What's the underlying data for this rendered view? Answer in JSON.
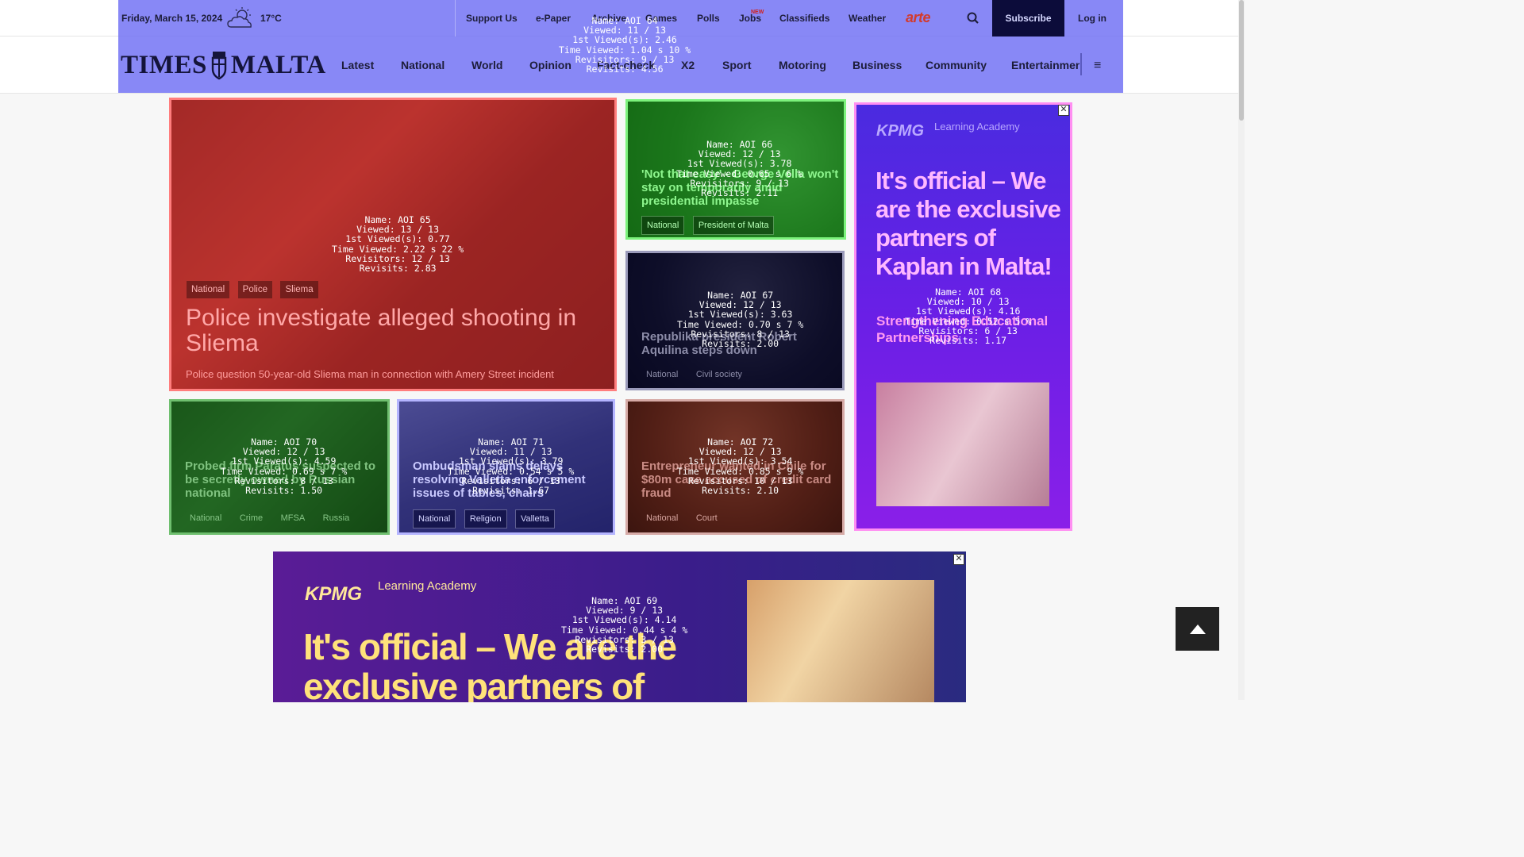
{
  "header": {
    "date": "Friday, March 15, 2024",
    "weather_icon": "partly-cloudy-icon",
    "temperature": "17°C",
    "utility_links": [
      "Support Us",
      "e-Paper",
      "Archive",
      "Games",
      "Polls",
      "Jobs",
      "Classifieds",
      "Weather"
    ],
    "jobs_badge": "NEW",
    "arte_logo": "arte",
    "search_icon": "search-icon",
    "subscribe_label": "Subscribe",
    "login_label": "Log in",
    "logo_text_left": "TIMES",
    "logo_text_right": "MALTA",
    "nav_links": [
      "Latest",
      "National",
      "World",
      "Opinion",
      "Fact-check",
      "X2",
      "Sport",
      "Motoring",
      "Business",
      "Community",
      "Entertainment"
    ],
    "menu_icon": "≡",
    "aoi": [
      "Name: AOI 64",
      "Viewed: 11 / 13",
      "1st Viewed(s): 2.46",
      "Time Viewed: 1.04 s 10 %",
      "Revisitors: 9 / 13",
      "Revisits: 4.56"
    ]
  },
  "cards": {
    "c65": {
      "tags": [
        "National",
        "Police",
        "Sliema"
      ],
      "title": "Police investigate alleged shooting in Sliema",
      "subtitle": "Police question 50-year-old Sliema man in connection with Amery Street incident",
      "aoi": [
        "Name: AOI 65",
        "Viewed: 13 / 13",
        "1st Viewed(s): 0.77",
        "Time Viewed: 2.22 s 22 %",
        "Revisitors: 12 / 13",
        "Revisits: 2.83"
      ]
    },
    "c66": {
      "title": "'Not that easy' - George Vella won't stay on temporarily amid presidential impasse",
      "tags": [
        "National",
        "President of Malta"
      ],
      "aoi": [
        "Name: AOI 66",
        "Viewed: 12 / 13",
        "1st Viewed(s): 3.78",
        "Time Viewed: 0.65 s 6 %",
        "Revisitors: 9 / 13",
        "Revisits: 2.11"
      ]
    },
    "c67": {
      "title": "Republika president Robert Aquilina steps down",
      "tags": [
        "National",
        "Civil society"
      ],
      "aoi": [
        "Name: AOI 67",
        "Viewed: 12 / 13",
        "1st Viewed(s): 3.63",
        "Time Viewed: 0.70 s 7 %",
        "Revisitors: 8 / 13",
        "Revisits: 2.00"
      ]
    },
    "c68": {
      "kpmg": "KPMG",
      "academy": "Learning Academy",
      "headline": "It's official – We are the exclusive partners of Kaplan in Malta!",
      "strength": "Strengthening Educational Partnerships",
      "close": "✕",
      "aoi": [
        "Name: AOI 68",
        "Viewed: 10 / 13",
        "1st Viewed(s): 4.16",
        "Time Viewed: 0.52 s 5 %",
        "Revisitors: 6 / 13",
        "Revisits: 1.17"
      ]
    },
    "c70": {
      "title": "Probed firm Paratus suspected to be secretly owned by Russian national",
      "tags": [
        "National",
        "Crime",
        "MFSA",
        "Russia"
      ],
      "aoi": [
        "Name: AOI 70",
        "Viewed: 12 / 13",
        "1st Viewed(s): 4.59",
        "Time Viewed: 0.69 s 7 %",
        "Revisitors: 8 / 13",
        "Revisits: 1.50"
      ]
    },
    "c71": {
      "title": "Ombudsman slams delays resolving Valletta enforcement issues of tables, chairs",
      "tags": [
        "National",
        "Religion",
        "Valletta"
      ],
      "aoi": [
        "Name: AOI 71",
        "Viewed: 11 / 13",
        "1st Viewed(s): 3.79",
        "Time Viewed: 0.54 s 5 %",
        "Revisitors: 6 / 13",
        "Revisits: 1.67"
      ]
    },
    "c72": {
      "title": "Entrepreneur wanted in Chile for $80m case accused of credit card fraud",
      "tags": [
        "National",
        "Court"
      ],
      "aoi": [
        "Name: AOI 72",
        "Viewed: 12 / 13",
        "1st Viewed(s): 3.54",
        "Time Viewed: 0.85 s 9 %",
        "Revisitors: 10 / 13",
        "Revisits: 2.10"
      ]
    },
    "c69": {
      "kpmg": "KPMG",
      "academy": "Learning Academy",
      "headline": "It's official – We are the exclusive partners of Kaplan in Malta!",
      "close": "✕",
      "aoi": [
        "Name: AOI 69",
        "Viewed: 9 / 13",
        "1st Viewed(s): 4.14",
        "Time Viewed: 0.44 s 4 %",
        "Revisitors: 3 / 13",
        "Revisits: 2.00"
      ]
    }
  },
  "scroll_top_icon": "arrow-up-icon",
  "colors": {
    "header_overlay": "#7878f5",
    "aoi65": "#ff7d7d",
    "aoi66": "#7cf27c",
    "aoi68": "#ff8ff2",
    "subscribe_bg": "#0c0c3a"
  }
}
